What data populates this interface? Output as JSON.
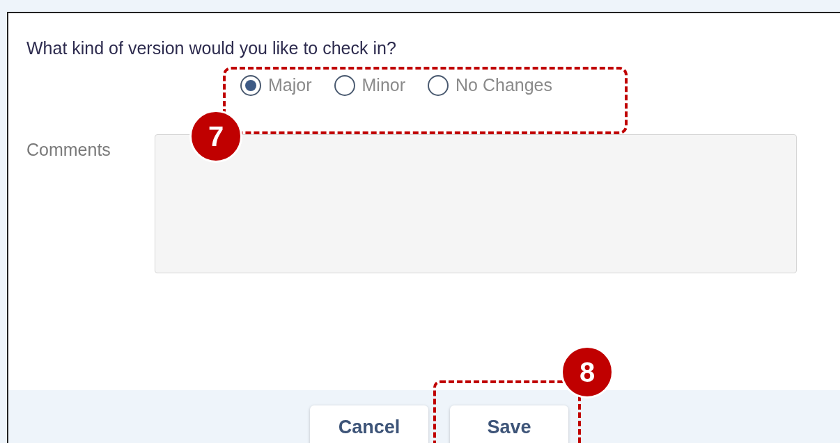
{
  "dialog": {
    "question": "What kind of version would you like to check in?",
    "version_options": [
      {
        "label": "Major",
        "selected": true
      },
      {
        "label": "Minor",
        "selected": false
      },
      {
        "label": "No Changes",
        "selected": false
      }
    ],
    "comments": {
      "label": "Comments"
    },
    "buttons": [
      {
        "label": "Cancel"
      },
      {
        "label": "Save"
      }
    ]
  },
  "callouts": [
    {
      "number": "7"
    },
    {
      "number": "8"
    }
  ]
}
